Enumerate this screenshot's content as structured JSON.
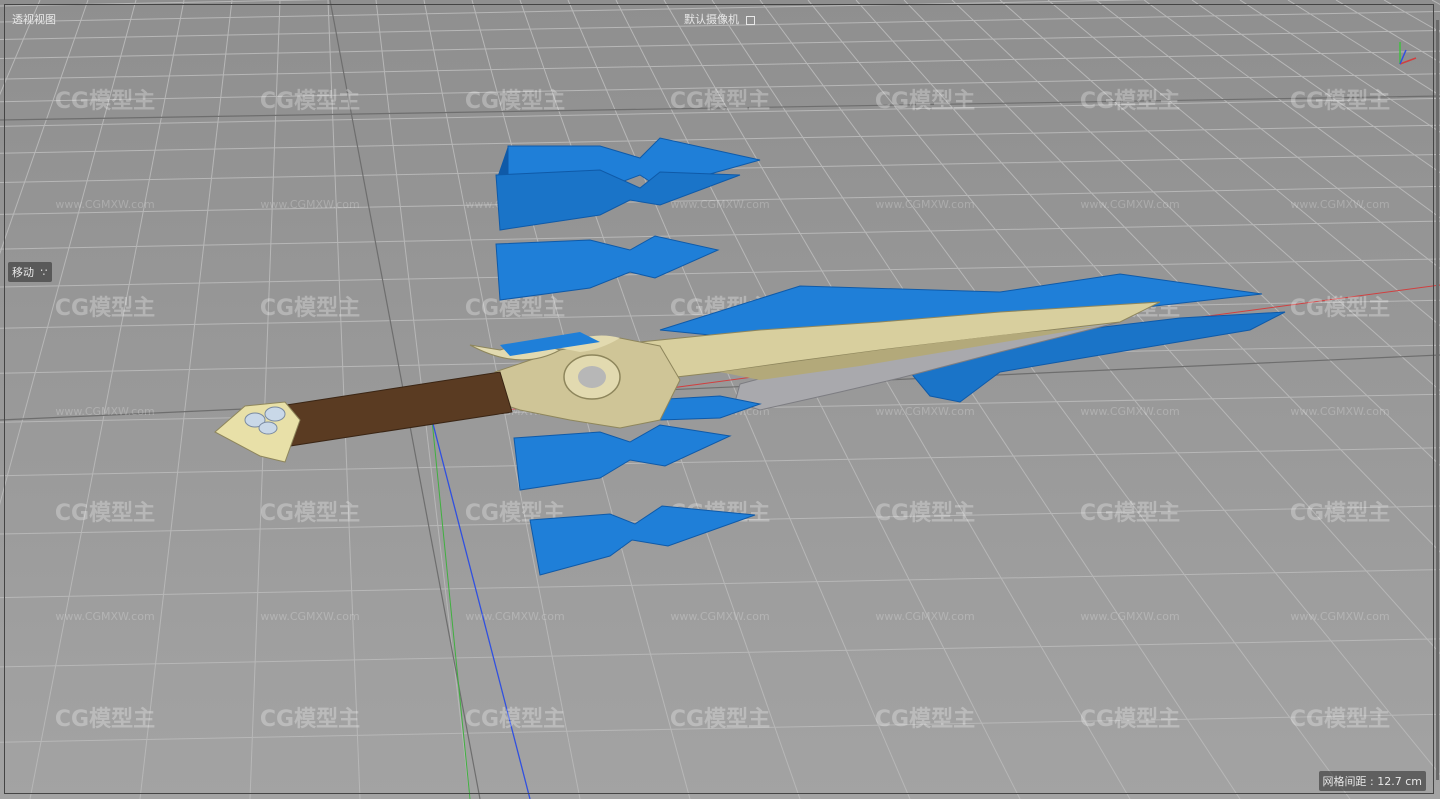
{
  "viewport": {
    "view_name": "透视视图",
    "camera_name": "默认摄像机",
    "camera_icon": "camera-square-icon",
    "active_tool": "移动",
    "tool_menu_icon": "dots-icon",
    "grid_spacing_text": "网格间距 : 12.7 cm"
  },
  "watermarks": {
    "logo_text": "CG模型主",
    "url_text": "www.CGMXW.com"
  },
  "model": {
    "name": "sword",
    "colors": {
      "blade_blue": "#1f7fd8",
      "blade_dark": "#0f5aa8",
      "bone": "#d8cf9e",
      "bone_shadow": "#b3a97a",
      "grip": "#5a3b22",
      "steel": "#a9a9ad",
      "pommel": "#e8e0a8"
    }
  },
  "colors": {
    "background": "#9a9a9a",
    "grid_line": "#b8b8b8",
    "axis_x": "#d04040",
    "axis_y": "#40c040",
    "axis_z": "#3050e0"
  }
}
